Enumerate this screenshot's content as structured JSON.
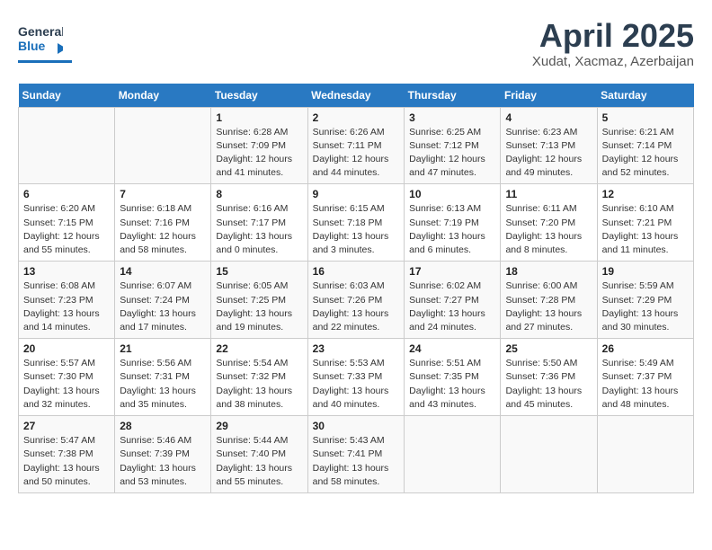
{
  "header": {
    "logo": {
      "line1": "General",
      "line2": "Blue"
    },
    "month": "April 2025",
    "location": "Xudat, Xacmaz, Azerbaijan"
  },
  "weekdays": [
    "Sunday",
    "Monday",
    "Tuesday",
    "Wednesday",
    "Thursday",
    "Friday",
    "Saturday"
  ],
  "weeks": [
    [
      {
        "day": "",
        "sunrise": "",
        "sunset": "",
        "daylight": ""
      },
      {
        "day": "",
        "sunrise": "",
        "sunset": "",
        "daylight": ""
      },
      {
        "day": "1",
        "sunrise": "Sunrise: 6:28 AM",
        "sunset": "Sunset: 7:09 PM",
        "daylight": "Daylight: 12 hours and 41 minutes."
      },
      {
        "day": "2",
        "sunrise": "Sunrise: 6:26 AM",
        "sunset": "Sunset: 7:11 PM",
        "daylight": "Daylight: 12 hours and 44 minutes."
      },
      {
        "day": "3",
        "sunrise": "Sunrise: 6:25 AM",
        "sunset": "Sunset: 7:12 PM",
        "daylight": "Daylight: 12 hours and 47 minutes."
      },
      {
        "day": "4",
        "sunrise": "Sunrise: 6:23 AM",
        "sunset": "Sunset: 7:13 PM",
        "daylight": "Daylight: 12 hours and 49 minutes."
      },
      {
        "day": "5",
        "sunrise": "Sunrise: 6:21 AM",
        "sunset": "Sunset: 7:14 PM",
        "daylight": "Daylight: 12 hours and 52 minutes."
      }
    ],
    [
      {
        "day": "6",
        "sunrise": "Sunrise: 6:20 AM",
        "sunset": "Sunset: 7:15 PM",
        "daylight": "Daylight: 12 hours and 55 minutes."
      },
      {
        "day": "7",
        "sunrise": "Sunrise: 6:18 AM",
        "sunset": "Sunset: 7:16 PM",
        "daylight": "Daylight: 12 hours and 58 minutes."
      },
      {
        "day": "8",
        "sunrise": "Sunrise: 6:16 AM",
        "sunset": "Sunset: 7:17 PM",
        "daylight": "Daylight: 13 hours and 0 minutes."
      },
      {
        "day": "9",
        "sunrise": "Sunrise: 6:15 AM",
        "sunset": "Sunset: 7:18 PM",
        "daylight": "Daylight: 13 hours and 3 minutes."
      },
      {
        "day": "10",
        "sunrise": "Sunrise: 6:13 AM",
        "sunset": "Sunset: 7:19 PM",
        "daylight": "Daylight: 13 hours and 6 minutes."
      },
      {
        "day": "11",
        "sunrise": "Sunrise: 6:11 AM",
        "sunset": "Sunset: 7:20 PM",
        "daylight": "Daylight: 13 hours and 8 minutes."
      },
      {
        "day": "12",
        "sunrise": "Sunrise: 6:10 AM",
        "sunset": "Sunset: 7:21 PM",
        "daylight": "Daylight: 13 hours and 11 minutes."
      }
    ],
    [
      {
        "day": "13",
        "sunrise": "Sunrise: 6:08 AM",
        "sunset": "Sunset: 7:23 PM",
        "daylight": "Daylight: 13 hours and 14 minutes."
      },
      {
        "day": "14",
        "sunrise": "Sunrise: 6:07 AM",
        "sunset": "Sunset: 7:24 PM",
        "daylight": "Daylight: 13 hours and 17 minutes."
      },
      {
        "day": "15",
        "sunrise": "Sunrise: 6:05 AM",
        "sunset": "Sunset: 7:25 PM",
        "daylight": "Daylight: 13 hours and 19 minutes."
      },
      {
        "day": "16",
        "sunrise": "Sunrise: 6:03 AM",
        "sunset": "Sunset: 7:26 PM",
        "daylight": "Daylight: 13 hours and 22 minutes."
      },
      {
        "day": "17",
        "sunrise": "Sunrise: 6:02 AM",
        "sunset": "Sunset: 7:27 PM",
        "daylight": "Daylight: 13 hours and 24 minutes."
      },
      {
        "day": "18",
        "sunrise": "Sunrise: 6:00 AM",
        "sunset": "Sunset: 7:28 PM",
        "daylight": "Daylight: 13 hours and 27 minutes."
      },
      {
        "day": "19",
        "sunrise": "Sunrise: 5:59 AM",
        "sunset": "Sunset: 7:29 PM",
        "daylight": "Daylight: 13 hours and 30 minutes."
      }
    ],
    [
      {
        "day": "20",
        "sunrise": "Sunrise: 5:57 AM",
        "sunset": "Sunset: 7:30 PM",
        "daylight": "Daylight: 13 hours and 32 minutes."
      },
      {
        "day": "21",
        "sunrise": "Sunrise: 5:56 AM",
        "sunset": "Sunset: 7:31 PM",
        "daylight": "Daylight: 13 hours and 35 minutes."
      },
      {
        "day": "22",
        "sunrise": "Sunrise: 5:54 AM",
        "sunset": "Sunset: 7:32 PM",
        "daylight": "Daylight: 13 hours and 38 minutes."
      },
      {
        "day": "23",
        "sunrise": "Sunrise: 5:53 AM",
        "sunset": "Sunset: 7:33 PM",
        "daylight": "Daylight: 13 hours and 40 minutes."
      },
      {
        "day": "24",
        "sunrise": "Sunrise: 5:51 AM",
        "sunset": "Sunset: 7:35 PM",
        "daylight": "Daylight: 13 hours and 43 minutes."
      },
      {
        "day": "25",
        "sunrise": "Sunrise: 5:50 AM",
        "sunset": "Sunset: 7:36 PM",
        "daylight": "Daylight: 13 hours and 45 minutes."
      },
      {
        "day": "26",
        "sunrise": "Sunrise: 5:49 AM",
        "sunset": "Sunset: 7:37 PM",
        "daylight": "Daylight: 13 hours and 48 minutes."
      }
    ],
    [
      {
        "day": "27",
        "sunrise": "Sunrise: 5:47 AM",
        "sunset": "Sunset: 7:38 PM",
        "daylight": "Daylight: 13 hours and 50 minutes."
      },
      {
        "day": "28",
        "sunrise": "Sunrise: 5:46 AM",
        "sunset": "Sunset: 7:39 PM",
        "daylight": "Daylight: 13 hours and 53 minutes."
      },
      {
        "day": "29",
        "sunrise": "Sunrise: 5:44 AM",
        "sunset": "Sunset: 7:40 PM",
        "daylight": "Daylight: 13 hours and 55 minutes."
      },
      {
        "day": "30",
        "sunrise": "Sunrise: 5:43 AM",
        "sunset": "Sunset: 7:41 PM",
        "daylight": "Daylight: 13 hours and 58 minutes."
      },
      {
        "day": "",
        "sunrise": "",
        "sunset": "",
        "daylight": ""
      },
      {
        "day": "",
        "sunrise": "",
        "sunset": "",
        "daylight": ""
      },
      {
        "day": "",
        "sunrise": "",
        "sunset": "",
        "daylight": ""
      }
    ]
  ]
}
